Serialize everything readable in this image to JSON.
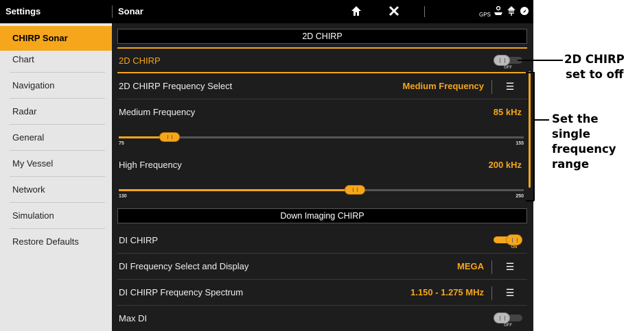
{
  "topbar": {
    "left_title": "Settings",
    "right_title": "Sonar",
    "icons": [
      "home-icon",
      "close-icon",
      "gps-icon",
      "ship-icon",
      "depth-icon",
      "compass-icon"
    ]
  },
  "sidebar": {
    "items": [
      {
        "label": "CHIRP Sonar",
        "active": true
      },
      {
        "label": "Chart"
      },
      {
        "label": "Navigation"
      },
      {
        "label": "Radar"
      },
      {
        "label": "General"
      },
      {
        "label": "My Vessel"
      },
      {
        "label": "Network"
      },
      {
        "label": "Simulation"
      },
      {
        "label": "Restore Defaults"
      }
    ]
  },
  "main": {
    "section_2d": "2D CHIRP",
    "row_2d_chirp": {
      "label": "2D CHIRP",
      "state": "OFF"
    },
    "row_freq_select": {
      "label": "2D CHIRP Frequency Select",
      "value": "Medium Frequency"
    },
    "row_medium": {
      "label": "Medium Frequency",
      "value": "85 kHz"
    },
    "slider_medium": {
      "min": "75",
      "max": "155",
      "current": 85
    },
    "row_high": {
      "label": "High Frequency",
      "value": "200 kHz"
    },
    "slider_high": {
      "min": "130",
      "max": "250",
      "current": 200
    },
    "section_di": "Down Imaging CHIRP",
    "row_di_chirp": {
      "label": "DI CHIRP",
      "state": "ON"
    },
    "row_di_select": {
      "label": "DI Frequency Select and Display",
      "value": "MEGA"
    },
    "row_di_spectrum": {
      "label": "DI CHIRP Frequency Spectrum",
      "value": "1.150 - 1.275 MHz"
    },
    "row_max_di": {
      "label": "Max DI",
      "state": "OFF"
    }
  },
  "annotations": {
    "off_line1": "2D CHIRP",
    "off_line2": "set to off",
    "range_line1": "Set the single",
    "range_line2": "frequency",
    "range_line3": "range"
  },
  "colors": {
    "accent": "#f5a61b",
    "background": "#1d1d1d",
    "sidebar": "#e6e6e6"
  }
}
